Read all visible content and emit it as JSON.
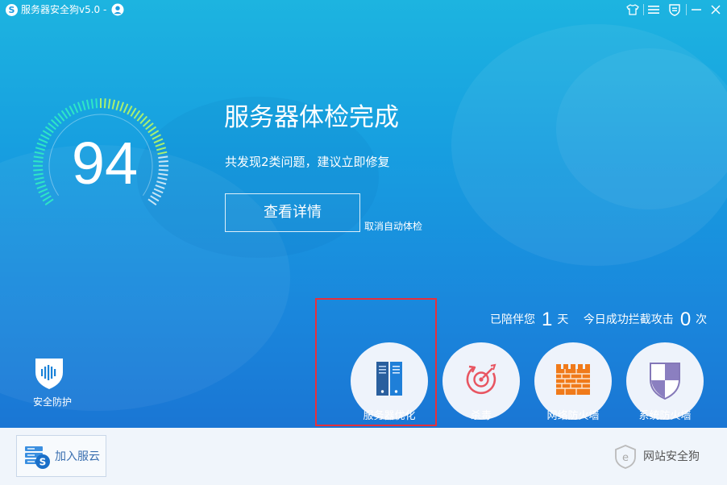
{
  "app": {
    "logo_letter": "S",
    "title": "服务器安全狗v5.0 -"
  },
  "scan": {
    "score": "94",
    "headline": "服务器体检完成",
    "summary": "共发现2类问题，建议立即修复",
    "details_button": "查看详情",
    "cancel_auto_check": "取消自动体检"
  },
  "stats": {
    "days_prefix": "已陪伴您",
    "days_value": "1",
    "days_suffix": "天",
    "attacks_prefix": "今日成功拦截攻击",
    "attacks_value": "0",
    "attacks_suffix": "次"
  },
  "protection": {
    "label": "安全防护",
    "icon": "shield-icon"
  },
  "tools": [
    {
      "label": "服务器优化",
      "icon": "server-rack-icon",
      "highlighted": true
    },
    {
      "label": "杀毒",
      "icon": "antivirus-target-icon"
    },
    {
      "label": "网络防火墙",
      "icon": "brick-wall-icon"
    },
    {
      "label": "系统防火墙",
      "icon": "shield-checker-icon"
    }
  ],
  "footer": {
    "join_cloud": "加入服云",
    "site_dog": "网站安全狗"
  },
  "colors": {
    "accent": "#1a86dc",
    "highlight_border": "#e8303a",
    "footer_bg": "#f0f5fb"
  }
}
